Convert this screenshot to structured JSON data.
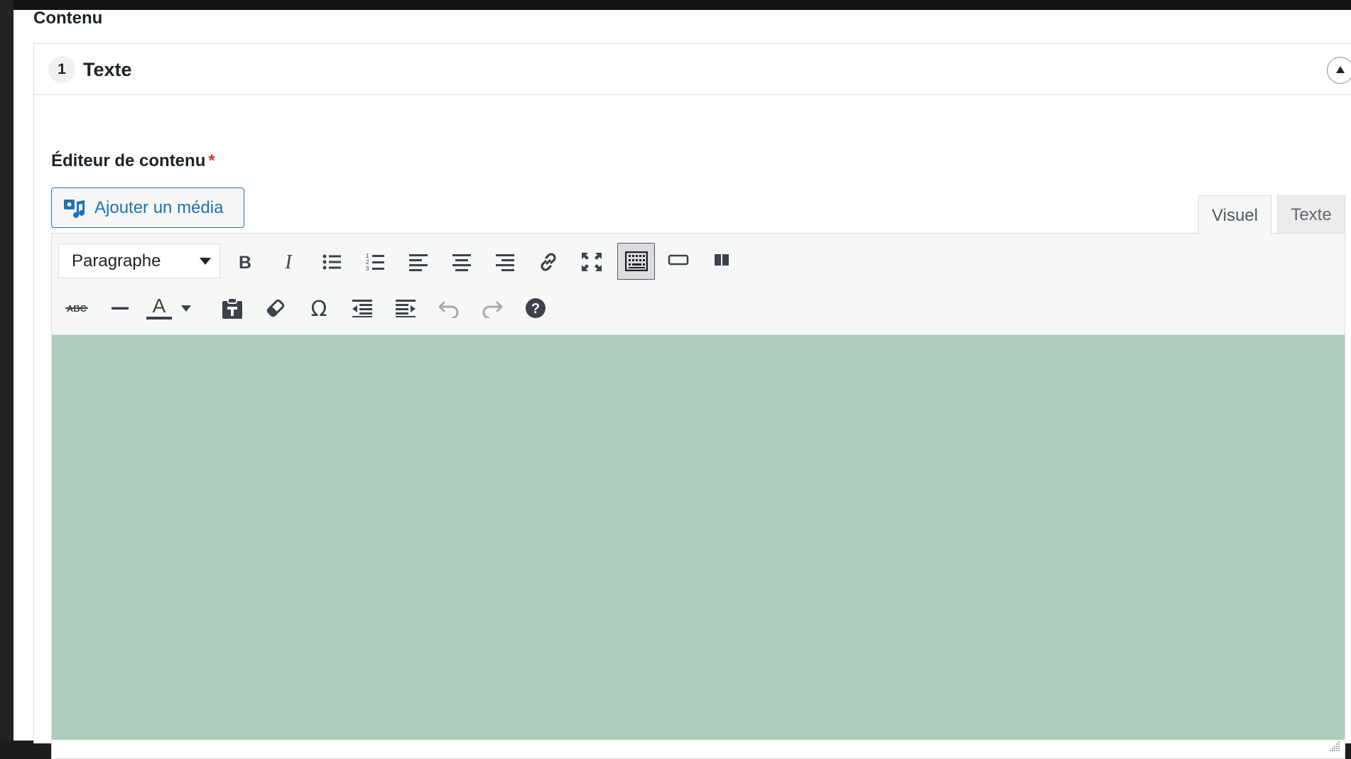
{
  "section": {
    "title": "Contenu"
  },
  "repeater_row": {
    "number": "1",
    "title": "Texte",
    "collapse_icon": "triangle-up-icon"
  },
  "field": {
    "label": "Éditeur de contenu",
    "required_mark": "*"
  },
  "media_button": {
    "label": "Ajouter un média",
    "icon": "media-icon"
  },
  "editor_tabs": [
    {
      "label": "Visuel",
      "active": true
    },
    {
      "label": "Texte",
      "active": false
    }
  ],
  "toolbar": {
    "format_select": {
      "value": "Paragraphe"
    },
    "row1_icons": [
      "bold-icon",
      "italic-icon",
      "bullet-list-icon",
      "numbered-list-icon",
      "align-left-icon",
      "align-center-icon",
      "align-right-icon",
      "link-icon",
      "fullscreen-icon",
      "toolbar-toggle-icon",
      "read-more-icon",
      "columns-icon"
    ],
    "row2_icons": [
      "strikethrough-icon",
      "horizontal-line-icon",
      "text-color-icon",
      "paste-text-icon",
      "clear-formatting-icon",
      "special-character-icon",
      "outdent-icon",
      "indent-icon",
      "undo-icon",
      "redo-icon",
      "help-icon"
    ],
    "active_button": "toolbar-toggle-icon"
  },
  "colors": {
    "content_area": "#afcdbd",
    "accent": "#2271b1",
    "required": "#d63638"
  }
}
